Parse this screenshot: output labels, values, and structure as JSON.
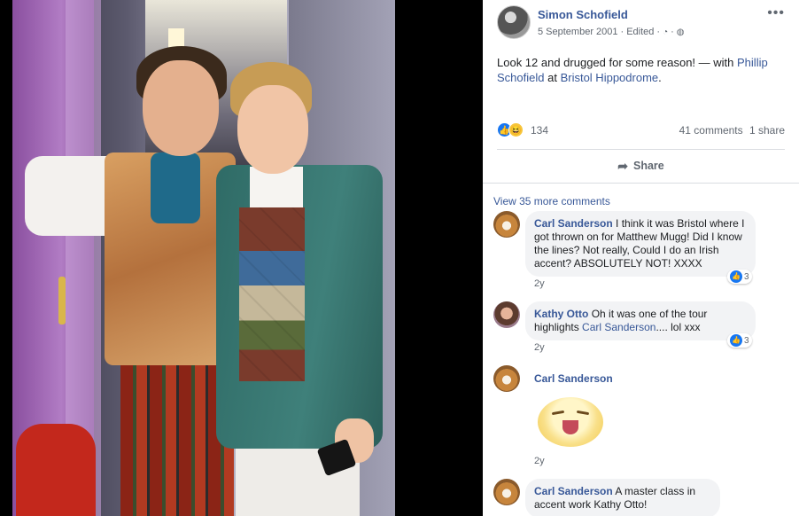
{
  "post": {
    "author": "Simon Schofield",
    "date": "5 September 2001",
    "edited": "Edited",
    "text_main": "Look 12 and drugged for some reason! — with",
    "tag_person": "Phillip Schofield",
    "text_at": "at",
    "tag_place": "Bristol Hippodrome",
    "text_end": "."
  },
  "icons": {
    "more": "more-options-icon",
    "privacy": "globe-icon",
    "history": "edit-history-icon",
    "share": "share-arrow-icon",
    "like": "like-thumb-icon",
    "haha": "haha-face-icon"
  },
  "reactions": {
    "count": "134",
    "comments": "41 comments",
    "shares": "1 share"
  },
  "actions": {
    "share_label": "Share"
  },
  "comments_section": {
    "view_more": "View 35 more comments",
    "items": [
      {
        "author": "Carl Sanderson",
        "text": "I think it was Bristol where I got thrown on for Matthew Mugg! Did I know the lines? Not really, Could I do an Irish accent? ABSOLUTELY NOT! XXXX",
        "time": "2y",
        "likes": "3"
      },
      {
        "author": "Kathy Otto",
        "text": "Oh it was one of the tour highlights",
        "mention": "Carl Sanderson",
        "text_end": ".... lol xxx",
        "time": "2y",
        "likes": "3"
      },
      {
        "author": "Carl Sanderson",
        "text": "",
        "time": "2y"
      },
      {
        "author": "Carl Sanderson",
        "text": "A master class in accent work Kathy Otto!"
      }
    ]
  },
  "colors": {
    "link": "#385898",
    "text": "#1c1e21",
    "muted": "#606770",
    "bubble": "#f2f3f5",
    "like_blue": "#1877f2"
  }
}
